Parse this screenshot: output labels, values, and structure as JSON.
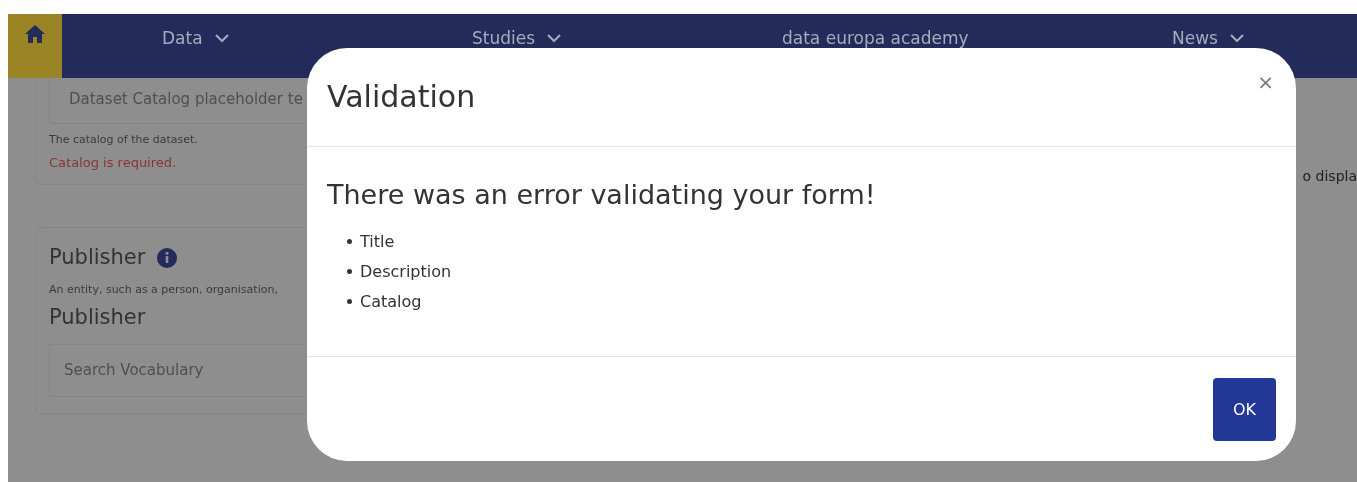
{
  "nav": {
    "items": [
      {
        "label": "Data",
        "dropdown": true
      },
      {
        "label": "Studies",
        "dropdown": true
      },
      {
        "label": "data europa academy",
        "dropdown": false
      },
      {
        "label": "News",
        "dropdown": true
      }
    ]
  },
  "catalog_field": {
    "placeholder": "Dataset Catalog placeholder te",
    "hint": "The catalog of the dataset.",
    "error": "Catalog is required."
  },
  "publisher": {
    "title": "Publisher",
    "description": "An entity, such as a person, organisation,",
    "label": "Publisher",
    "search_placeholder": "Search Vocabulary"
  },
  "right_fragment": "o displa",
  "modal": {
    "title": "Validation",
    "close": "×",
    "heading": "There was an error validating your form!",
    "errors": [
      "Title",
      "Description",
      "Catalog"
    ],
    "button": "OK"
  }
}
